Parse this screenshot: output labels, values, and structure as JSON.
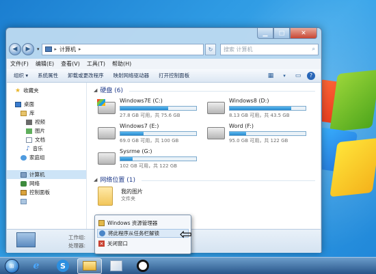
{
  "window": {
    "address": {
      "computer": "计算机",
      "search_placeholder": "搜索 计算机"
    },
    "menu": [
      "文件(F)",
      "编辑(E)",
      "查看(V)",
      "工具(T)",
      "帮助(H)"
    ],
    "commands": [
      "组织",
      "系统属性",
      "卸载或更改程序",
      "映射网络驱动器",
      "打开控制面板"
    ],
    "nav": {
      "favorites": "收藏夹",
      "desktop": "桌面",
      "library": "库",
      "videos": "视频",
      "pictures": "图片",
      "documents": "文档",
      "music": "音乐",
      "homegroup": "家庭组",
      "computer": "计算机",
      "network": "网络",
      "control_panel": "控制面板"
    },
    "hard_disks": {
      "header": "硬盘 (6)",
      "drives": [
        {
          "name": "Windows7E (C:)",
          "info": "27.8 GB 可用，共 75.6 GB",
          "used": 0.63
        },
        {
          "name": "Windows8 (D:)",
          "info": "8.13 GB 可用，共 43.5 GB",
          "used": 0.81
        },
        {
          "name": "Windows7 (E:)",
          "info": "69.0 GB 可用，共 100 GB",
          "used": 0.31
        },
        {
          "name": "Word (F:)",
          "info": "95.0 GB 可用，共 122 GB",
          "used": 0.22
        },
        {
          "name": "Sysrme (G:)",
          "info": "102 GB 可用，共 122 GB",
          "used": 0.16
        }
      ]
    },
    "network_location": {
      "header": "网络位置 (1)",
      "item_name": "我的图片",
      "item_type": "文件夹"
    },
    "details": {
      "workgroup_label": "工作组:",
      "processor_label": "处理器:"
    }
  },
  "jump_list": {
    "items": [
      "Windows 资源管理器",
      "将此程序从任务栏解锁",
      "关闭窗口"
    ]
  },
  "colors": {
    "accent": "#2788cc",
    "desktop": "#2e9ae3"
  }
}
